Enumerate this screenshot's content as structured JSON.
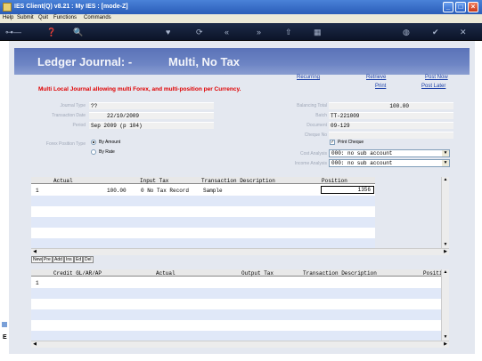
{
  "window": {
    "title": "IES Client(Q) v8.21 : My IES :      [mode-Z]"
  },
  "menu": [
    "Help",
    "Submit",
    "Quit",
    "Functions",
    "Commands"
  ],
  "header": {
    "title_left": "Ledger Journal: -",
    "title_right": "Multi, No Tax"
  },
  "links": {
    "recurring": "Recurring",
    "retrieve": "Retrieve",
    "post_now": "Post Now",
    "print": "Print",
    "post_later": "Post Later"
  },
  "message": "Multi Local Journal allowing multi Forex, and multi-position per Currency.",
  "form": {
    "journal_type_label": "Journal Type",
    "journal_type_value": "??",
    "transaction_date_label": "Transaction Date",
    "transaction_date_value": "22/10/2009",
    "period_label": "Period",
    "period_value": "Sep 2009 (p 104)",
    "balancing_total_label": "Balancing Total",
    "balancing_total_value": "100.00",
    "batch_label": "Batch",
    "batch_value": "TT-221009",
    "document_label": "Document",
    "document_value": "09-129",
    "cheque_no_label": "Cheque No",
    "print_cheque_label": "Print Cheque",
    "posn_type_label": "Forex Position Type",
    "by_amount": "By Amount",
    "by_rate": "By Rate",
    "cost_analysis_label": "Cost Analysis",
    "cost_analysis_value": "000: no sub account",
    "income_analysis_label": "Income Analysis",
    "income_analysis_value": "000: no sub account"
  },
  "grid_top": {
    "columns": [
      "Actual",
      "Input Tax",
      "Transaction Description",
      "Position"
    ],
    "rows": [
      {
        "num": "1",
        "actual": "100.00",
        "input_tax": "0 No Tax Record",
        "description": "Sample",
        "position": "1356"
      }
    ]
  },
  "row_buttons": [
    "New",
    "Pre",
    "Add",
    "Ins",
    "Ed",
    "Del"
  ],
  "grid_bottom": {
    "columns": [
      "Credit GL/AR/AP",
      "Actual",
      "Output Tax",
      "Transaction Description",
      "Positi"
    ],
    "rows": [
      {
        "num": "1"
      }
    ]
  }
}
